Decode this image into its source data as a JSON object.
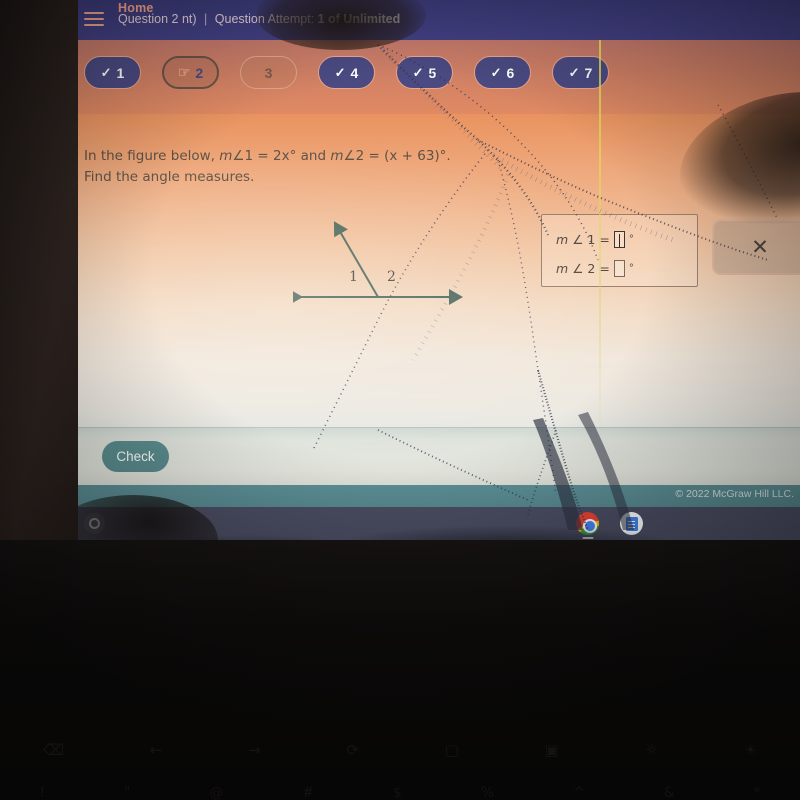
{
  "header": {
    "menu_icon": "hamburger-menu-icon",
    "home_label": "Home",
    "question_label": "Question 2",
    "assignment_suffix": "nt)",
    "separator": "|",
    "attempt_prefix": "Question Attempt: ",
    "attempt_value": "1 of Unlimited"
  },
  "nav": {
    "pills": [
      {
        "number": "1",
        "icon": "check-icon",
        "state": "done"
      },
      {
        "number": "2",
        "icon": "hand-pointer-icon",
        "state": "current"
      },
      {
        "number": "3",
        "icon": "",
        "state": "plain"
      },
      {
        "number": "4",
        "icon": "check-icon",
        "state": "done"
      },
      {
        "number": "5",
        "icon": "check-icon",
        "state": "done"
      },
      {
        "number": "6",
        "icon": "check-icon",
        "state": "done"
      },
      {
        "number": "7",
        "icon": "check-icon",
        "state": "done"
      }
    ],
    "check_glyph": "✓",
    "hand_glyph": "☞"
  },
  "question": {
    "line1_a": "In the figure below, ",
    "m1": "m",
    "angle_glyph": "∠",
    "expr1": "1 = 2x°",
    "and": " and ",
    "m2": "m",
    "expr2": "2 = (x + 63)°.",
    "line2": "Find the angle measures."
  },
  "figure": {
    "label_1": "1",
    "label_2": "2",
    "line_color": "#4f6a5e",
    "description": "horizontal-line-with-upward-ray"
  },
  "answer": {
    "row1_m": "m",
    "row1_angle": "∠",
    "row1_num": "1",
    "row1_eq": "=",
    "row1_value": "",
    "row2_m": "m",
    "row2_angle": "∠",
    "row2_num": "2",
    "row2_eq": "=",
    "row2_value": "",
    "degree": "°"
  },
  "overlay_panel": {
    "close_glyph": "✕"
  },
  "footer": {
    "check_label": "Check",
    "copyright": "© 2022 McGraw Hill LLC."
  },
  "shelf": {
    "launcher_name": "launcher-icon",
    "apps": [
      {
        "name": "chrome-icon",
        "label": "Chrome",
        "active": true
      },
      {
        "name": "google-docs-icon",
        "label": "Docs",
        "active": false
      }
    ]
  },
  "keyboard": {
    "function_row": [
      "⌫",
      "←",
      "→",
      "⟳",
      "▢",
      "▣",
      "☼",
      "☀"
    ],
    "number_row": [
      "!",
      "\"",
      "@",
      "#",
      "$",
      "%",
      "^",
      "&",
      "*"
    ]
  },
  "colors": {
    "header_purple": "#434083",
    "nav_orange": "#cf7f65",
    "content_gradient_top": "#e9935f",
    "teal_footer": "#588b92",
    "check_button": "#5b8d8e",
    "pill_done": "#4b4a82",
    "shelf": "#4b4e63",
    "crack_yellow": "#e8e25a",
    "crack_cyan": "#6ee2ec"
  }
}
